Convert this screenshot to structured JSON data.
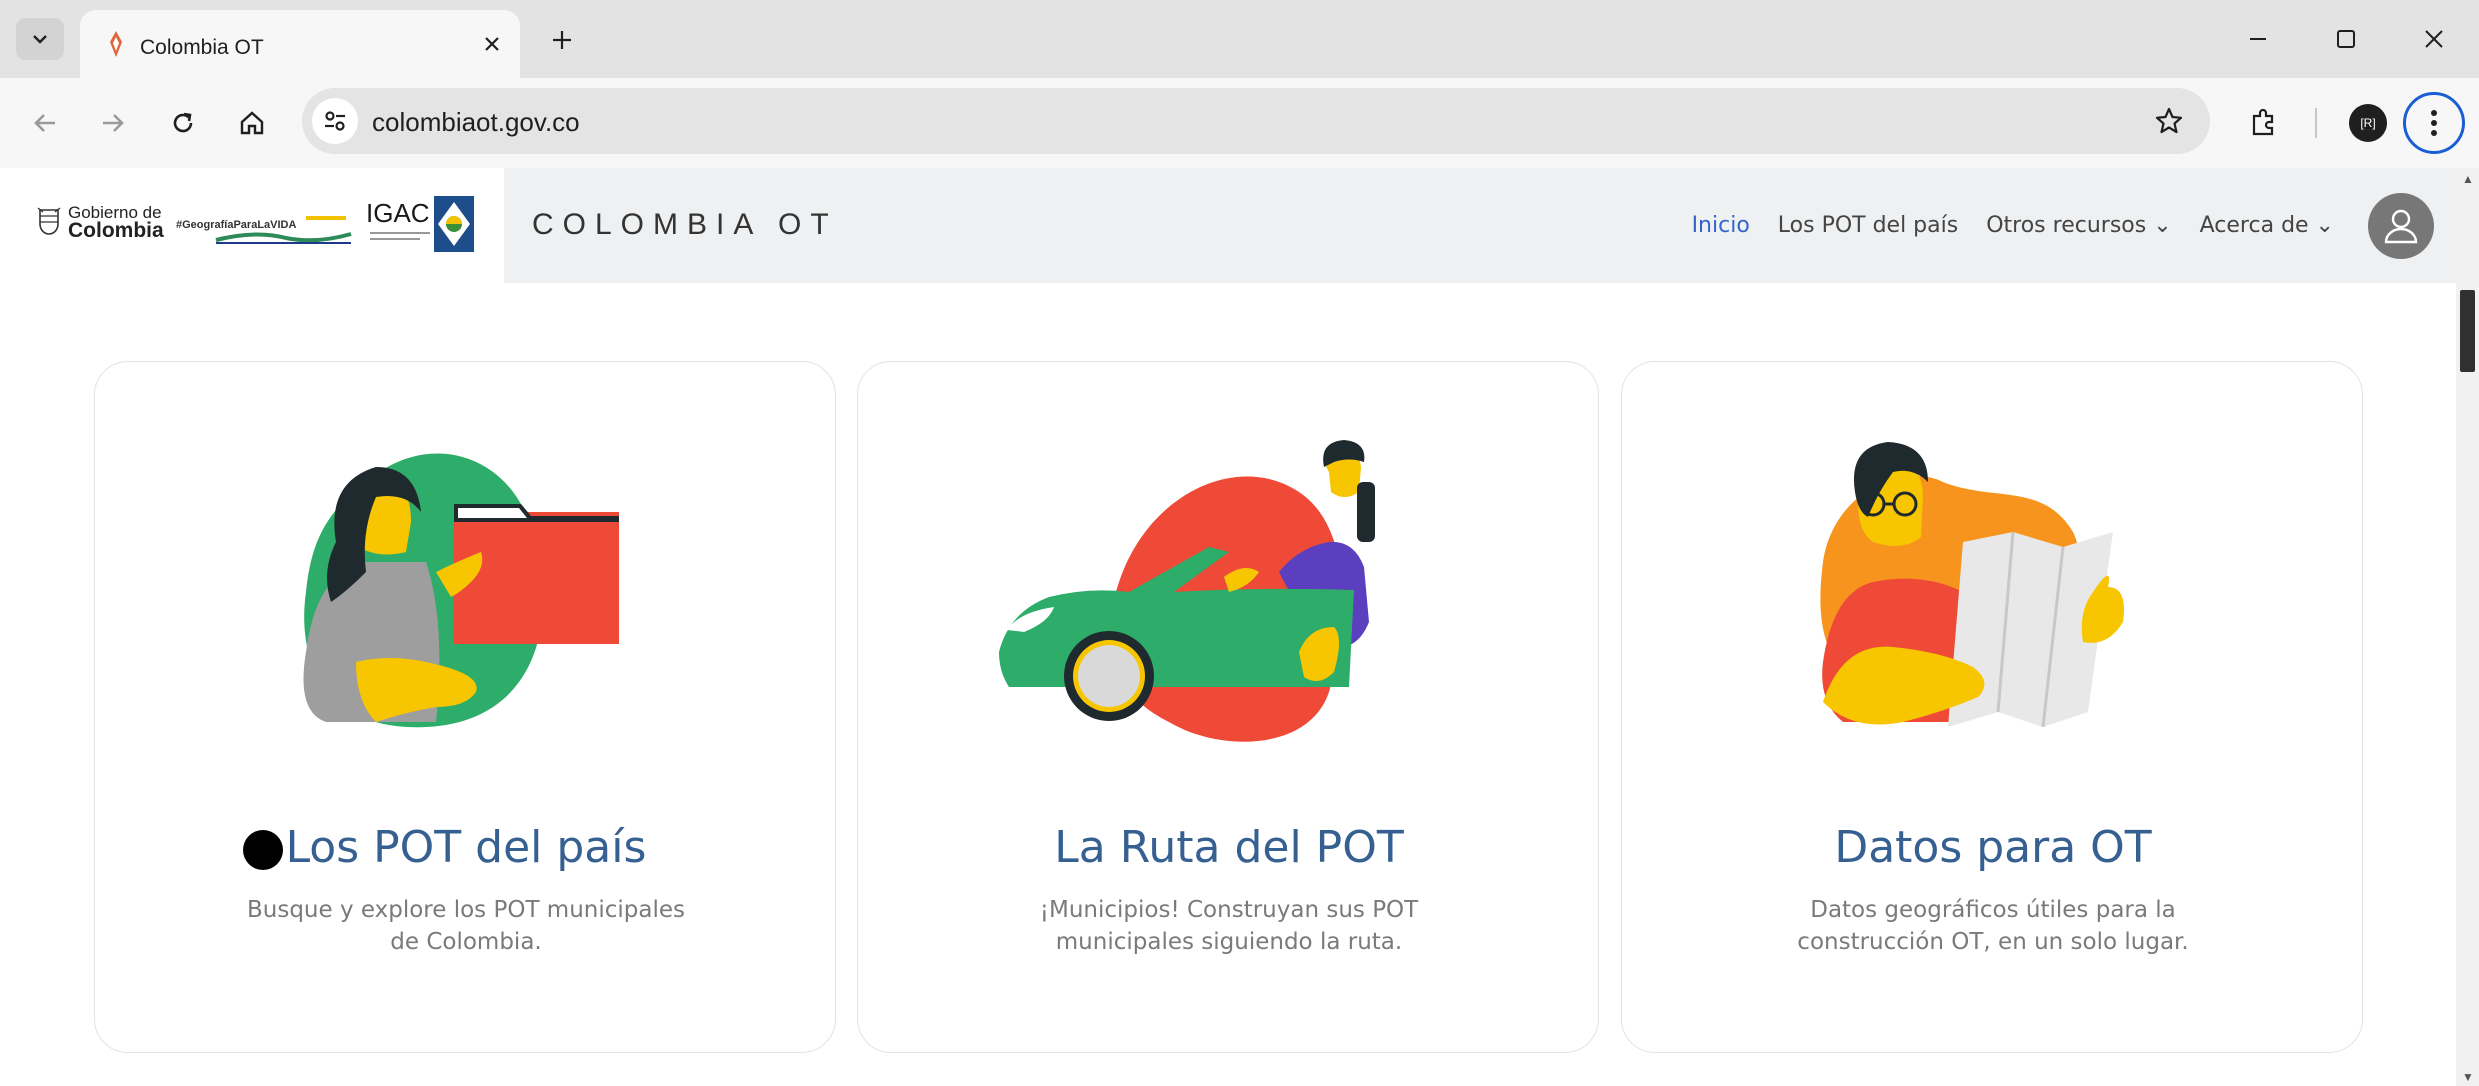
{
  "browser": {
    "tab_title": "Colombia OT",
    "url": "colombiaot.gov.co",
    "profile_label": "[R]"
  },
  "header": {
    "logos": {
      "gobierno_line1": "Gobierno de",
      "gobierno_line2": "Colombia",
      "vida_text": "#GeografíaParaLaVIDA",
      "igac_text": "IGAC"
    },
    "brand": "COLOMBIA OT",
    "nav": [
      {
        "label": "Inicio",
        "active": true
      },
      {
        "label": "Los POT del país",
        "active": false
      },
      {
        "label": "Otros recursos ⌄",
        "active": false
      },
      {
        "label": "Acerca de ⌄",
        "active": false
      }
    ]
  },
  "cards": [
    {
      "title": "Los POT del país",
      "description": "Busque y explore los POT municipales de Colombia.",
      "blob_color": "#2eac69",
      "illustration": "woman-with-folder"
    },
    {
      "title": "La Ruta del POT",
      "description": "¡Municipios! Construyan sus POT municipales siguiendo la ruta.",
      "blob_color": "#ee4a37",
      "illustration": "man-driving-car"
    },
    {
      "title": "Datos para OT",
      "description": "Datos geográficos útiles para la construcción OT, en un solo lugar.",
      "blob_color": "#f7941d",
      "illustration": "man-reading-map"
    }
  ],
  "colors": {
    "accent": "#366092",
    "nav_active": "#3366cc",
    "header_bg": "#eef0f2"
  }
}
